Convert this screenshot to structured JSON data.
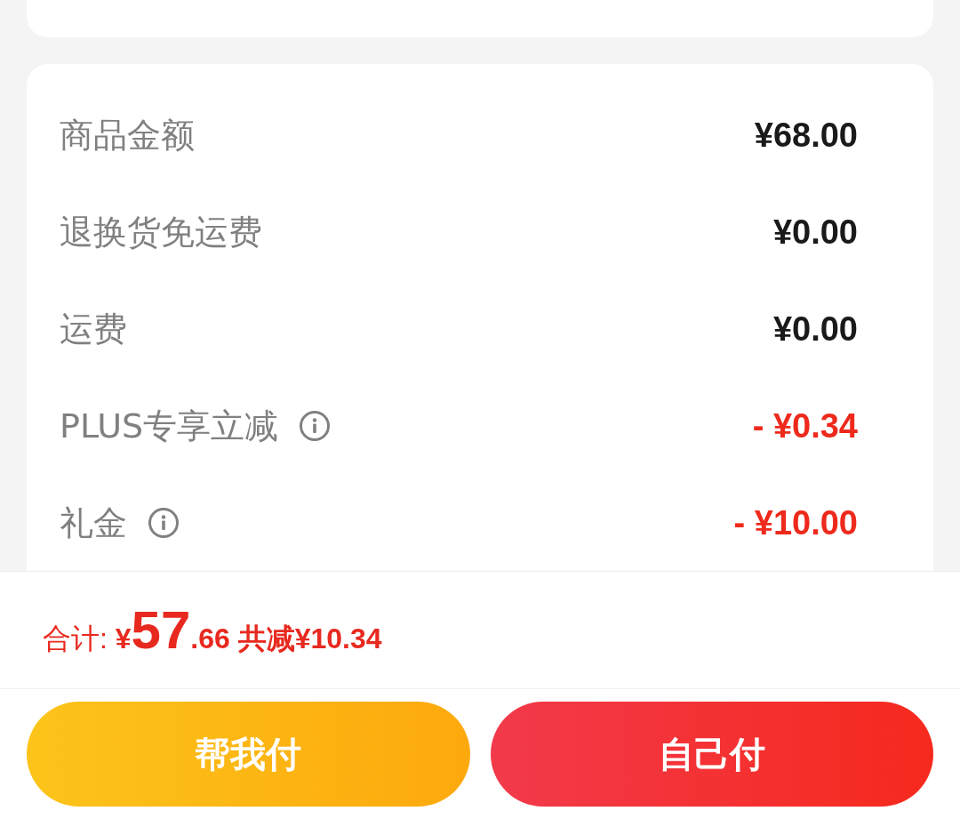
{
  "price_summary": {
    "rows": [
      {
        "label": "商品金额",
        "value": "¥68.00",
        "kind": "charge",
        "info": false
      },
      {
        "label": "退换货免运费",
        "value": "¥0.00",
        "kind": "charge",
        "info": false
      },
      {
        "label": "运费",
        "value": "¥0.00",
        "kind": "charge",
        "info": false
      },
      {
        "label": "PLUS专享立减",
        "value": "- ¥0.34",
        "kind": "discount",
        "info": true
      },
      {
        "label": "礼金",
        "value": "- ¥10.00",
        "kind": "discount",
        "info": true
      }
    ]
  },
  "total": {
    "label": "合计:",
    "currency": "¥",
    "integer": "57",
    "decimal": ".66",
    "savings": "共减¥10.34"
  },
  "buttons": [
    {
      "label": "帮我付",
      "kind": "secondary"
    },
    {
      "label": "自己付",
      "kind": "primary"
    }
  ]
}
